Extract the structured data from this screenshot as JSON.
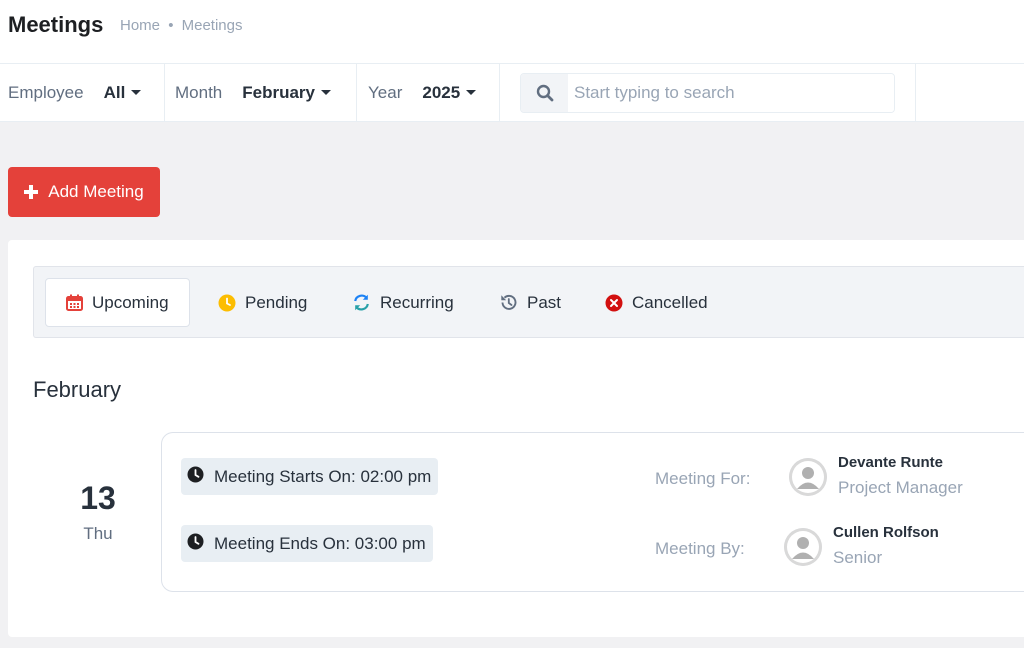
{
  "header": {
    "title": "Meetings",
    "breadcrumb": [
      "Home",
      "Meetings"
    ],
    "breadcrumb_separator": "•"
  },
  "filters": {
    "employee": {
      "label": "Employee",
      "value": "All"
    },
    "month": {
      "label": "Month",
      "value": "February"
    },
    "year": {
      "label": "Year",
      "value": "2025"
    },
    "search": {
      "placeholder": "Start typing to search",
      "value": "",
      "icon": "search-icon"
    }
  },
  "actions": {
    "add_meeting": "Add Meeting",
    "add_icon": "plus-icon"
  },
  "tabs": [
    {
      "label": "Upcoming",
      "icon": "calendar-icon",
      "color": "#e4413a",
      "active": true
    },
    {
      "label": "Pending",
      "icon": "clock-icon",
      "color": "#fcbd01",
      "active": false
    },
    {
      "label": "Recurring",
      "icon": "refresh-icon",
      "color": "#1d82f5",
      "active": false
    },
    {
      "label": "Past",
      "icon": "history-icon",
      "color": "#616e80",
      "active": false
    },
    {
      "label": "Cancelled",
      "icon": "times-circle-icon",
      "color": "#d21010",
      "active": false
    }
  ],
  "month_heading": "February",
  "meetings": [
    {
      "day": "13",
      "weekday": "Thu",
      "starts": "Meeting Starts On: 02:00 pm",
      "ends": "Meeting Ends On: 03:00 pm",
      "for_label": "Meeting For:",
      "for_person": {
        "name": "Devante Runte",
        "role": "Project Manager"
      },
      "by_label": "Meeting By:",
      "by_person": {
        "name": "Cullen Rolfson",
        "role": "Senior"
      }
    }
  ],
  "colors": {
    "accent_red": "#e4413a",
    "text_dark": "#28313c",
    "text_muted": "#99a5b5",
    "background": "#f1f1f3"
  }
}
